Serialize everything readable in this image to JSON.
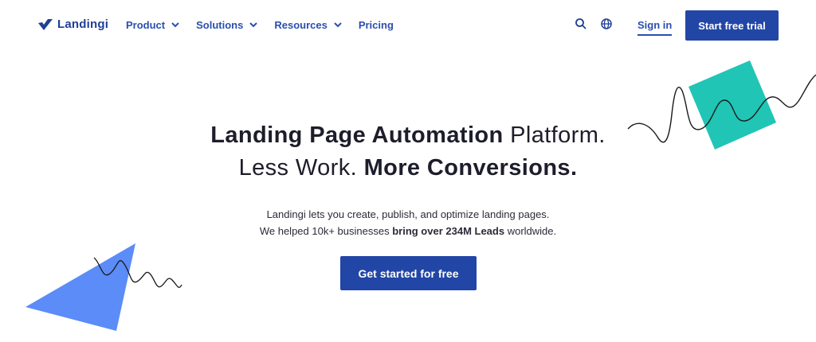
{
  "brand": {
    "name": "Landingi",
    "color": "#1f3f94"
  },
  "nav": {
    "items": [
      {
        "label": "Product",
        "has_dropdown": true
      },
      {
        "label": "Solutions",
        "has_dropdown": true
      },
      {
        "label": "Resources",
        "has_dropdown": true
      },
      {
        "label": "Pricing",
        "has_dropdown": false
      }
    ],
    "icons": [
      "search-icon",
      "globe-icon"
    ],
    "sign_in": "Sign in",
    "trial_button": "Start free trial"
  },
  "hero": {
    "title_line1_bold": "Landing Page Automation",
    "title_line1_regular": "Platform.",
    "title_line2_regular": "Less Work.",
    "title_line2_bold": "More Conversions.",
    "sub_line1": "Landingi lets you create, publish, and optimize landing pages.",
    "sub_line2_pre": "We helped 10k+ businesses",
    "sub_line2_bold": "bring over 234M Leads",
    "sub_line2_post": "worldwide.",
    "cta": "Get started for free"
  },
  "colors": {
    "primary": "#2246a6",
    "link": "#2b4fb0",
    "teal_square": "#20c5b5",
    "blue_triangle": "#5b8cf8"
  }
}
